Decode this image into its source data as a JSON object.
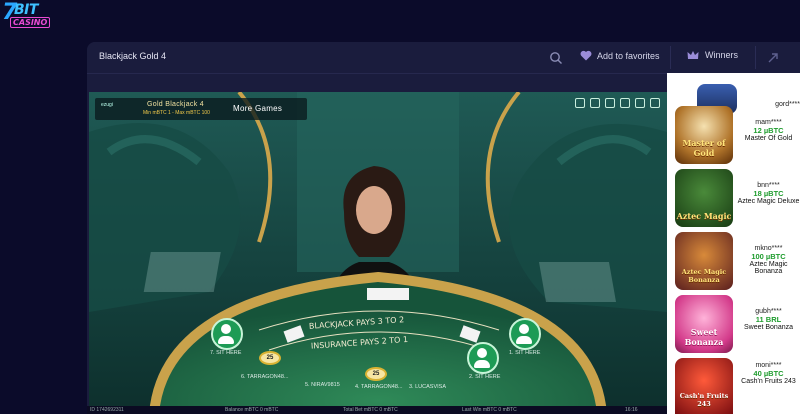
{
  "logo": {
    "text": "BIT",
    "subtext": "CASINO"
  },
  "header": {
    "game_title": "Blackjack Gold 4",
    "favorites_label": "Add to favorites",
    "winners_label": "Winners"
  },
  "video": {
    "table_name": "Gold Blackjack 4",
    "limits": "Min mBTC 1 - Max mBTC 100",
    "more_games": "More Games",
    "provider": "ezugi",
    "seats": [
      {
        "label": "7. SIT HERE"
      },
      {
        "label": "2. SIT HERE"
      },
      {
        "label": "1. SIT HERE"
      }
    ],
    "players": [
      {
        "name": "6. TARRAGON48...",
        "chip": "25"
      },
      {
        "name": "5. NIRAV9815",
        "chip": ""
      },
      {
        "name": "4. TARRAGON48...",
        "chip": "25"
      },
      {
        "name": "3. LUCASVISA",
        "chip": ""
      }
    ],
    "status": {
      "id": "ID 1742692311",
      "balance": "Balance  mBTC 0 mBTC",
      "total_bet": "Total Bet mBTC 0 mBTC",
      "last_win": "Last Win mBTC 0 mBTC",
      "time": "16:16"
    }
  },
  "winners": [
    {
      "user": "gord****",
      "amount": "",
      "game": ""
    },
    {
      "user": "mam****",
      "amount": "12 µBTC",
      "game": "Master Of Gold"
    },
    {
      "user": "bnn****",
      "amount": "18 µBTC",
      "game": "Aztec Magic Deluxe"
    },
    {
      "user": "mkno****",
      "amount": "100 µBTC",
      "game": "Aztec Magic Bonanza"
    },
    {
      "user": "gubh****",
      "amount": "11 BRL",
      "game": "Sweet Bonanza"
    },
    {
      "user": "moni****",
      "amount": "40 µBTC",
      "game": "Cash'n Fruits 243"
    }
  ],
  "thumb_titles": [
    "Master of Gold",
    "Aztec Magic",
    "Aztec Magic Bonanza",
    "Sweet Bonanza",
    "Cash'n Fruits 243"
  ],
  "colors": {
    "page_bg": "#0b0b2a",
    "frame_bg": "#1a1c3d",
    "felt": "#1f6a44",
    "win_green": "#1f9c2e"
  }
}
